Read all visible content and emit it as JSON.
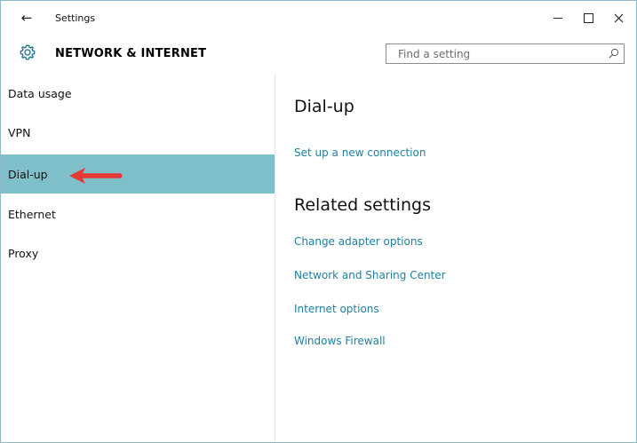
{
  "window": {
    "title": "Settings"
  },
  "header": {
    "section_title": "NETWORK & INTERNET",
    "search_placeholder": "Find a setting"
  },
  "sidebar": {
    "items": [
      {
        "label": "Data usage"
      },
      {
        "label": "VPN"
      },
      {
        "label": "Dial-up",
        "selected": true
      },
      {
        "label": "Ethernet"
      },
      {
        "label": "Proxy"
      }
    ]
  },
  "main": {
    "heading": "Dial-up",
    "setup_link": "Set up a new connection",
    "related_heading": "Related settings",
    "related_links": [
      "Change adapter options",
      "Network and Sharing Center",
      "Internet options",
      "Windows Firewall"
    ]
  },
  "colors": {
    "accent_selected": "#7fbfc9",
    "link": "#1e7fa0",
    "annotation_arrow": "#e53935"
  }
}
